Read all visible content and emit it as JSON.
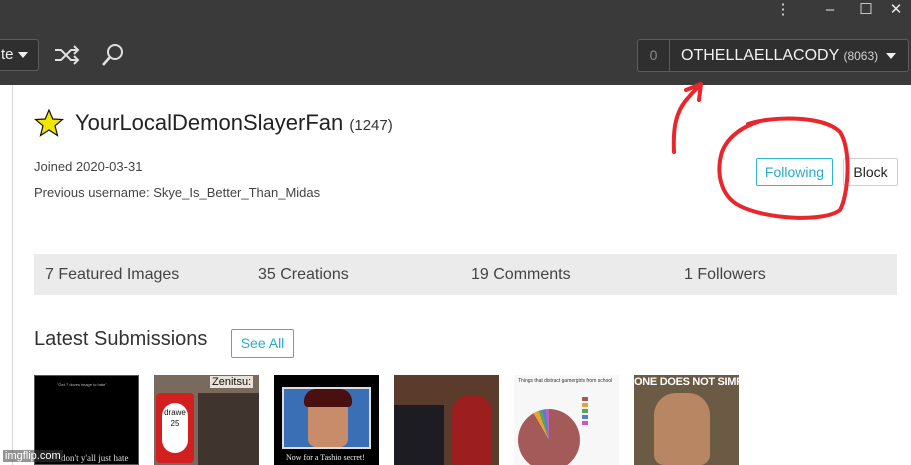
{
  "topbar": {
    "create_label": "te",
    "notif_count": "0",
    "username": "OTHELLAELLACODY",
    "user_points": "(8063)",
    "window_controls": [
      "⋮",
      "–",
      "☐",
      "✕"
    ],
    "icons": [
      "shuffle-icon",
      "search-icon"
    ]
  },
  "profile": {
    "name": "YourLocalDemonSlayerFan",
    "score": "(1247)",
    "joined": "Joined 2020-03-31",
    "previous_username": "Previous username: Skye_Is_Better_Than_Midas",
    "following_label": "Following",
    "block_label": "Block"
  },
  "stats": [
    "7 Featured Images",
    "35 Creations",
    "19 Comments",
    "1 Followers"
  ],
  "latest": {
    "title": "Latest Submissions",
    "see_all": "See All",
    "thumbs": [
      {
        "top_text": "\"Get 7 doves image to hate\"",
        "caption": "don't y'all just hate"
      },
      {
        "label": "Zenitsu:",
        "card_text": "drawe 25"
      },
      {
        "caption": "Now for a Tashio secret!"
      },
      {},
      {
        "title": "Things that distract gamergirls from school"
      },
      {
        "text": "ONE DOES NOT SIMPLY"
      }
    ]
  },
  "watermark": "imgflip.com",
  "colors": {
    "topbar": "#3a3a3a",
    "accent": "#2aa9c9",
    "annotation_red": "#e8262b"
  }
}
